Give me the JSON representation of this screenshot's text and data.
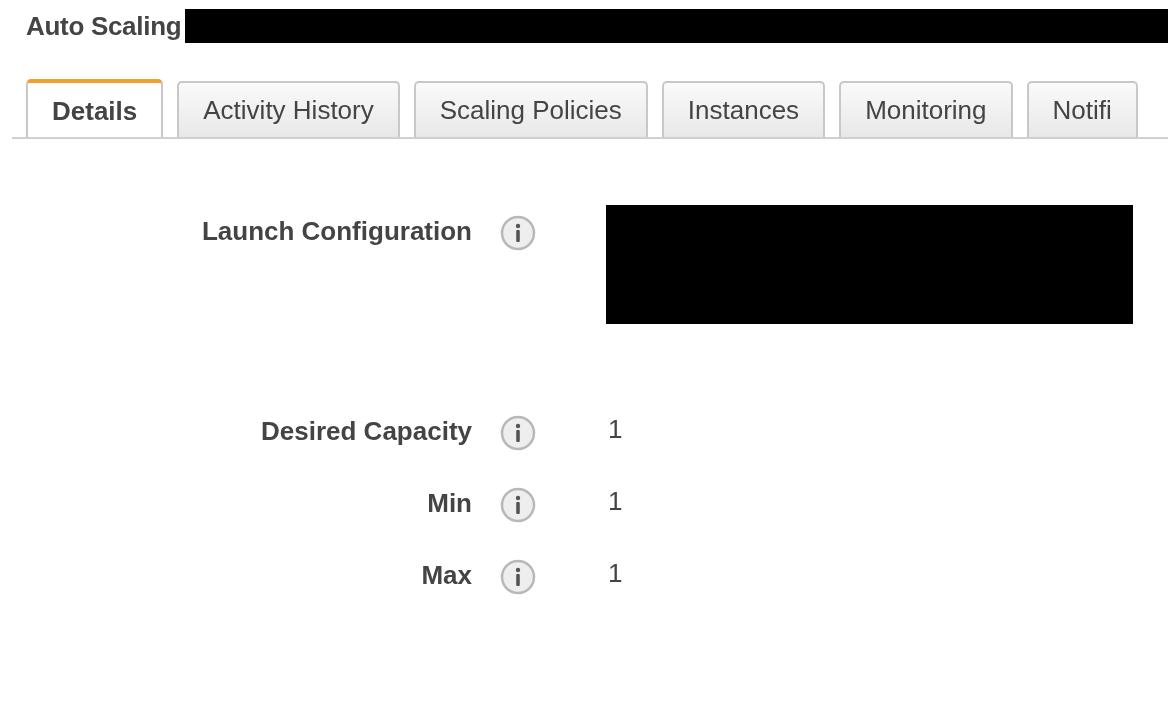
{
  "title": "Auto Scaling",
  "tabs": [
    {
      "label": "Details",
      "selected": true
    },
    {
      "label": "Activity History",
      "selected": false
    },
    {
      "label": "Scaling Policies",
      "selected": false
    },
    {
      "label": "Instances",
      "selected": false
    },
    {
      "label": "Monitoring",
      "selected": false
    },
    {
      "label": "Notifi",
      "selected": false
    }
  ],
  "fields": [
    {
      "label": "Launch Configuration",
      "kind": "redacted"
    },
    {
      "label": "Desired Capacity",
      "kind": "text",
      "value": "1"
    },
    {
      "label": "Min",
      "kind": "text",
      "value": "1"
    },
    {
      "label": "Max",
      "kind": "text",
      "value": "1"
    }
  ]
}
